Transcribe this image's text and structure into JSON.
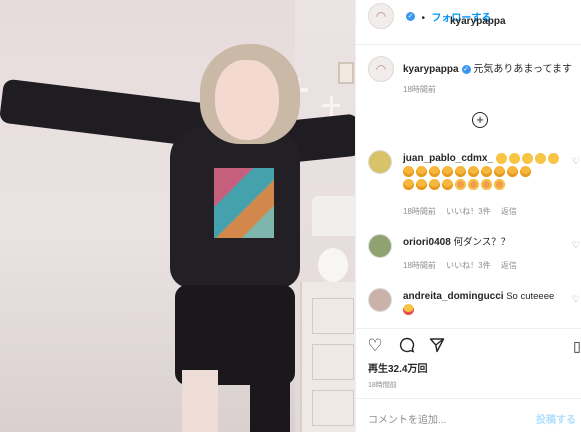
{
  "header": {
    "username": "kyarypappa",
    "separator": "•",
    "follow_label": "フォローする"
  },
  "caption": {
    "username": "kyarypappa",
    "text": "元気ありあまってます",
    "time": "18時間前"
  },
  "comments": [
    {
      "username": "juan_pablo_cdmx_",
      "emoji_rows": [
        [
          "clap",
          "clap",
          "clap",
          "clap",
          "clap"
        ],
        [
          "laugh",
          "laugh",
          "laugh",
          "laugh",
          "laugh",
          "laugh",
          "laugh",
          "laugh",
          "laugh",
          "laugh"
        ],
        [
          "laugh",
          "laugh",
          "laugh",
          "laugh",
          "heart",
          "heart",
          "heart",
          "heart"
        ]
      ],
      "time": "18時間前",
      "likes": "いいね！3件",
      "reply": "返信"
    },
    {
      "username": "oriori0408",
      "text": "何ダンス？？",
      "time": "18時間前",
      "likes": "いいね！3件",
      "reply": "返信"
    },
    {
      "username": "andreita_domingucci",
      "text": "So cuteeee",
      "emoji_rows": [
        [
          "hearteyes"
        ]
      ]
    }
  ],
  "stats": {
    "views": "再生32.4万回",
    "time": "18時間前"
  },
  "composer": {
    "placeholder": "コメントを追加...",
    "post_label": "投稿する"
  },
  "colors": {
    "accent": "#0095f6",
    "verified": "#3897f0"
  }
}
